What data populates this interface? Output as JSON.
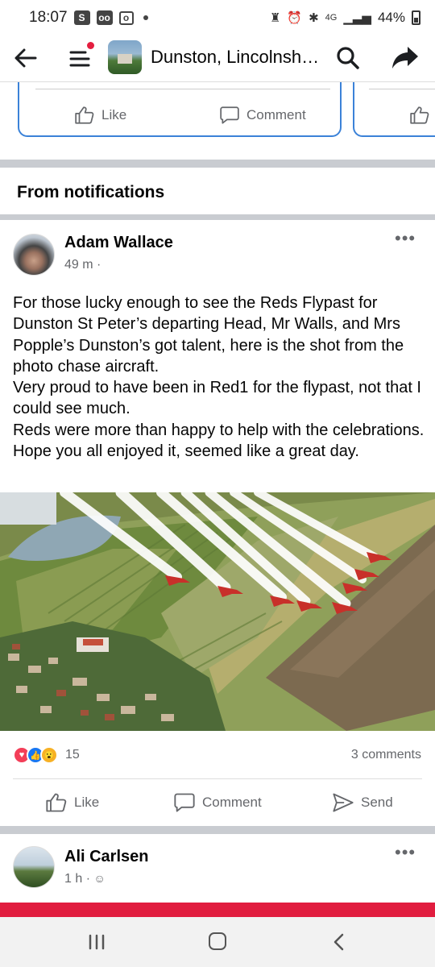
{
  "status_bar": {
    "time": "18:07",
    "left_icons": [
      "S",
      "oo",
      "o"
    ],
    "network": "4G",
    "battery": "44%"
  },
  "header": {
    "title": "Dunston, Lincolnsh…"
  },
  "carousel": {
    "like_label": "Like",
    "comment_label": "Comment"
  },
  "section": {
    "title": "From notifications"
  },
  "post": {
    "author": "Adam Wallace",
    "time": "49 m ·",
    "text_lines": [
      "For those lucky enough to see the Reds Flypast for Dunston St Peter’s departing Head, Mr Walls, and Mrs Popple’s Dunston’s got talent, here is the shot from the photo chase aircraft.",
      "Very proud to have been in Red1 for the flypast, not that I could see much.",
      "Reds were more than happy to help with the celebrations.",
      "Hope you all enjoyed it, seemed like a great day."
    ],
    "reaction_count": "15",
    "comments": "3 comments",
    "actions": {
      "like": "Like",
      "comment": "Comment",
      "send": "Send"
    }
  },
  "next_post": {
    "author": "Ali Carlsen",
    "time": "1 h ·"
  },
  "colors": {
    "accent_blue": "#3b82d8",
    "love": "#f33e58",
    "like": "#1877f2",
    "wow": "#f7b125",
    "banner_red": "#e11d3f",
    "separator": "#c9ccd1"
  },
  "icons": {
    "back": "arrow-left-icon",
    "menu": "hamburger-icon",
    "search": "search-icon",
    "share": "share-icon",
    "like": "thumbs-up-icon",
    "comment": "comment-bubble-icon",
    "send": "send-icon",
    "more": "more-dots-icon",
    "audience": "globe-icon"
  }
}
